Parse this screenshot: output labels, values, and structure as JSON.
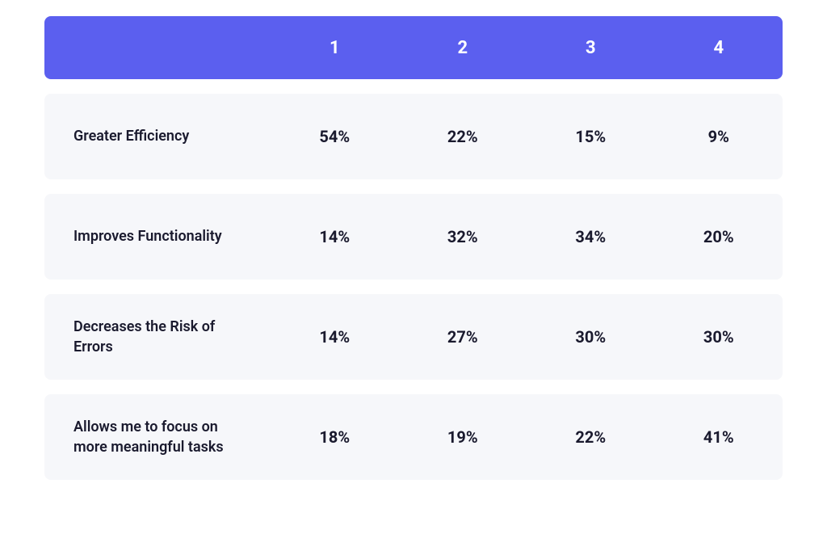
{
  "chart_data": {
    "type": "table",
    "title": "",
    "columns": [
      "1",
      "2",
      "3",
      "4"
    ],
    "rows": [
      {
        "label": "Greater Efficiency",
        "values": [
          "54%",
          "22%",
          "15%",
          "9%"
        ]
      },
      {
        "label": "Improves Functionality",
        "values": [
          "14%",
          "32%",
          "34%",
          "20%"
        ]
      },
      {
        "label": "Decreases the Risk of Errors",
        "values": [
          "14%",
          "27%",
          "30%",
          "30%"
        ]
      },
      {
        "label": "Allows me to focus on more meaningful tasks",
        "values": [
          "18%",
          "19%",
          "22%",
          "41%"
        ]
      }
    ]
  }
}
